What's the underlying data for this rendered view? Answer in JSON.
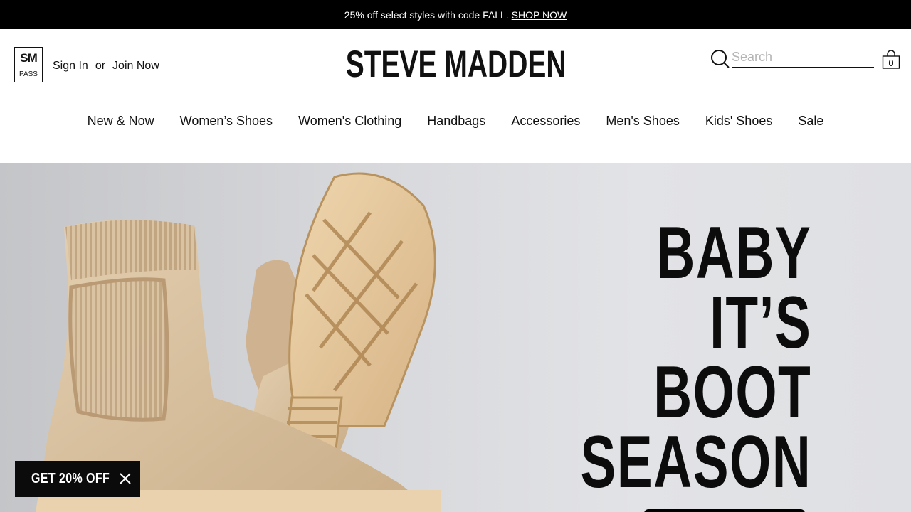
{
  "promo": {
    "text": "25% off select styles with code FALL.",
    "link": "SHOP NOW"
  },
  "header": {
    "pass_top": "SM",
    "pass_bottom": "PASS",
    "sign_in": "Sign In",
    "or": "or",
    "join": "Join Now",
    "logo": "STEVE MADDEN",
    "search_placeholder": "Search",
    "cart_count": "0"
  },
  "nav": [
    "New & Now",
    "Women’s Shoes",
    "Women's Clothing",
    "Handbags",
    "Accessories",
    "Men's Shoes",
    "Kids' Shoes",
    "Sale"
  ],
  "hero": {
    "line1": "BABY",
    "line2": "IT’S",
    "line3": "BOOT",
    "line4": "SEASON"
  },
  "offer": {
    "label": "GET 20% OFF"
  },
  "colors": {
    "promo_bg": "#000000",
    "boot": "#d8bf9d",
    "sole": "#e6c89e",
    "hero_bg": "#d9dadd"
  }
}
